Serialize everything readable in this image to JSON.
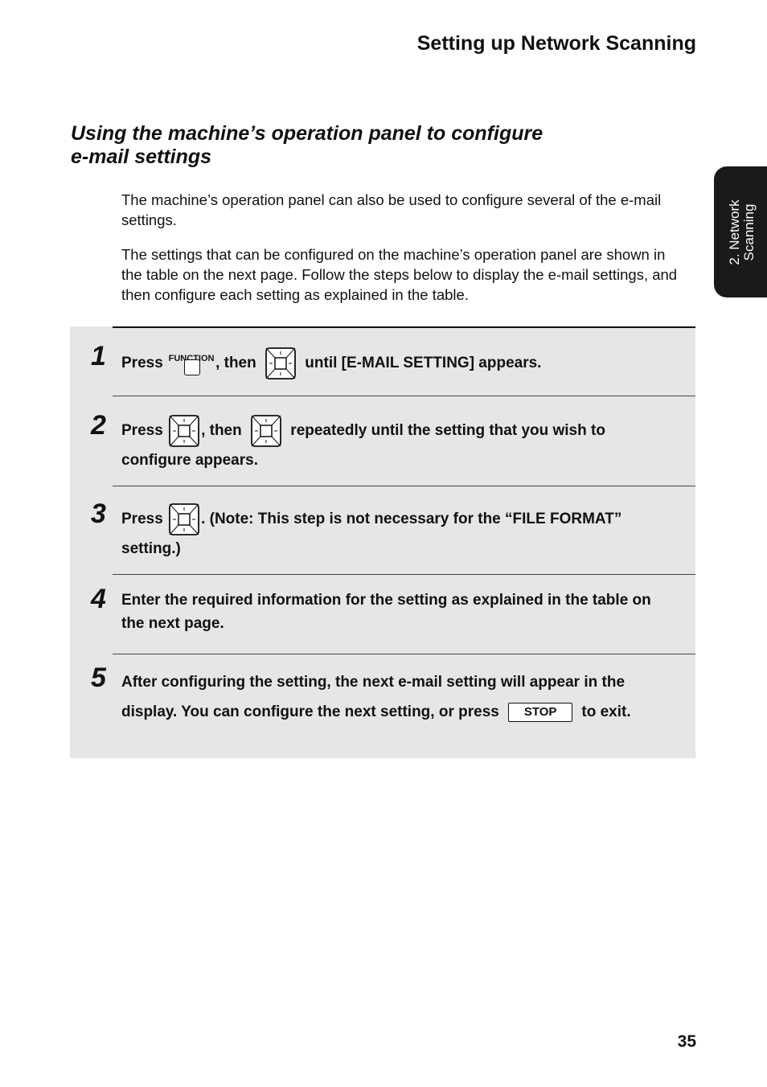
{
  "header": {
    "title": "Setting up Network Scanning"
  },
  "section": {
    "title_line1": "Using the machine’s operation panel to configure",
    "title_line2": "e-mail settings"
  },
  "intro": {
    "p1": "The machine’s operation panel can also be used to configure several of the e-mail settings.",
    "p2": "The settings that can be configured on the machine’s operation panel are shown in the table on the next page. Follow the steps below to display the e-mail settings, and then configure each setting as explained in the table."
  },
  "side_tab": {
    "line1": "2. Network",
    "line2": "Scanning"
  },
  "steps": [
    {
      "num": "1",
      "a": "Press",
      "fn_label": "FUNCTION",
      "b": ", then",
      "c": "until [E-MAIL SETTING] appears."
    },
    {
      "num": "2",
      "a": "Press",
      "b": ", then",
      "c": "repeatedly until the setting that you wish to configure appears."
    },
    {
      "num": "3",
      "a": "Press",
      "b": ". (Note: This step is not necessary for the “FILE FORMAT” setting.)"
    },
    {
      "num": "4",
      "a": "Enter the required information for the setting as explained in the table on the next page."
    },
    {
      "num": "5",
      "a": "After configuring the setting, the next e-mail setting will appear in the display. You can configure the next setting, or press",
      "stop": "STOP",
      "b": "to exit."
    }
  ],
  "page_number": "35"
}
